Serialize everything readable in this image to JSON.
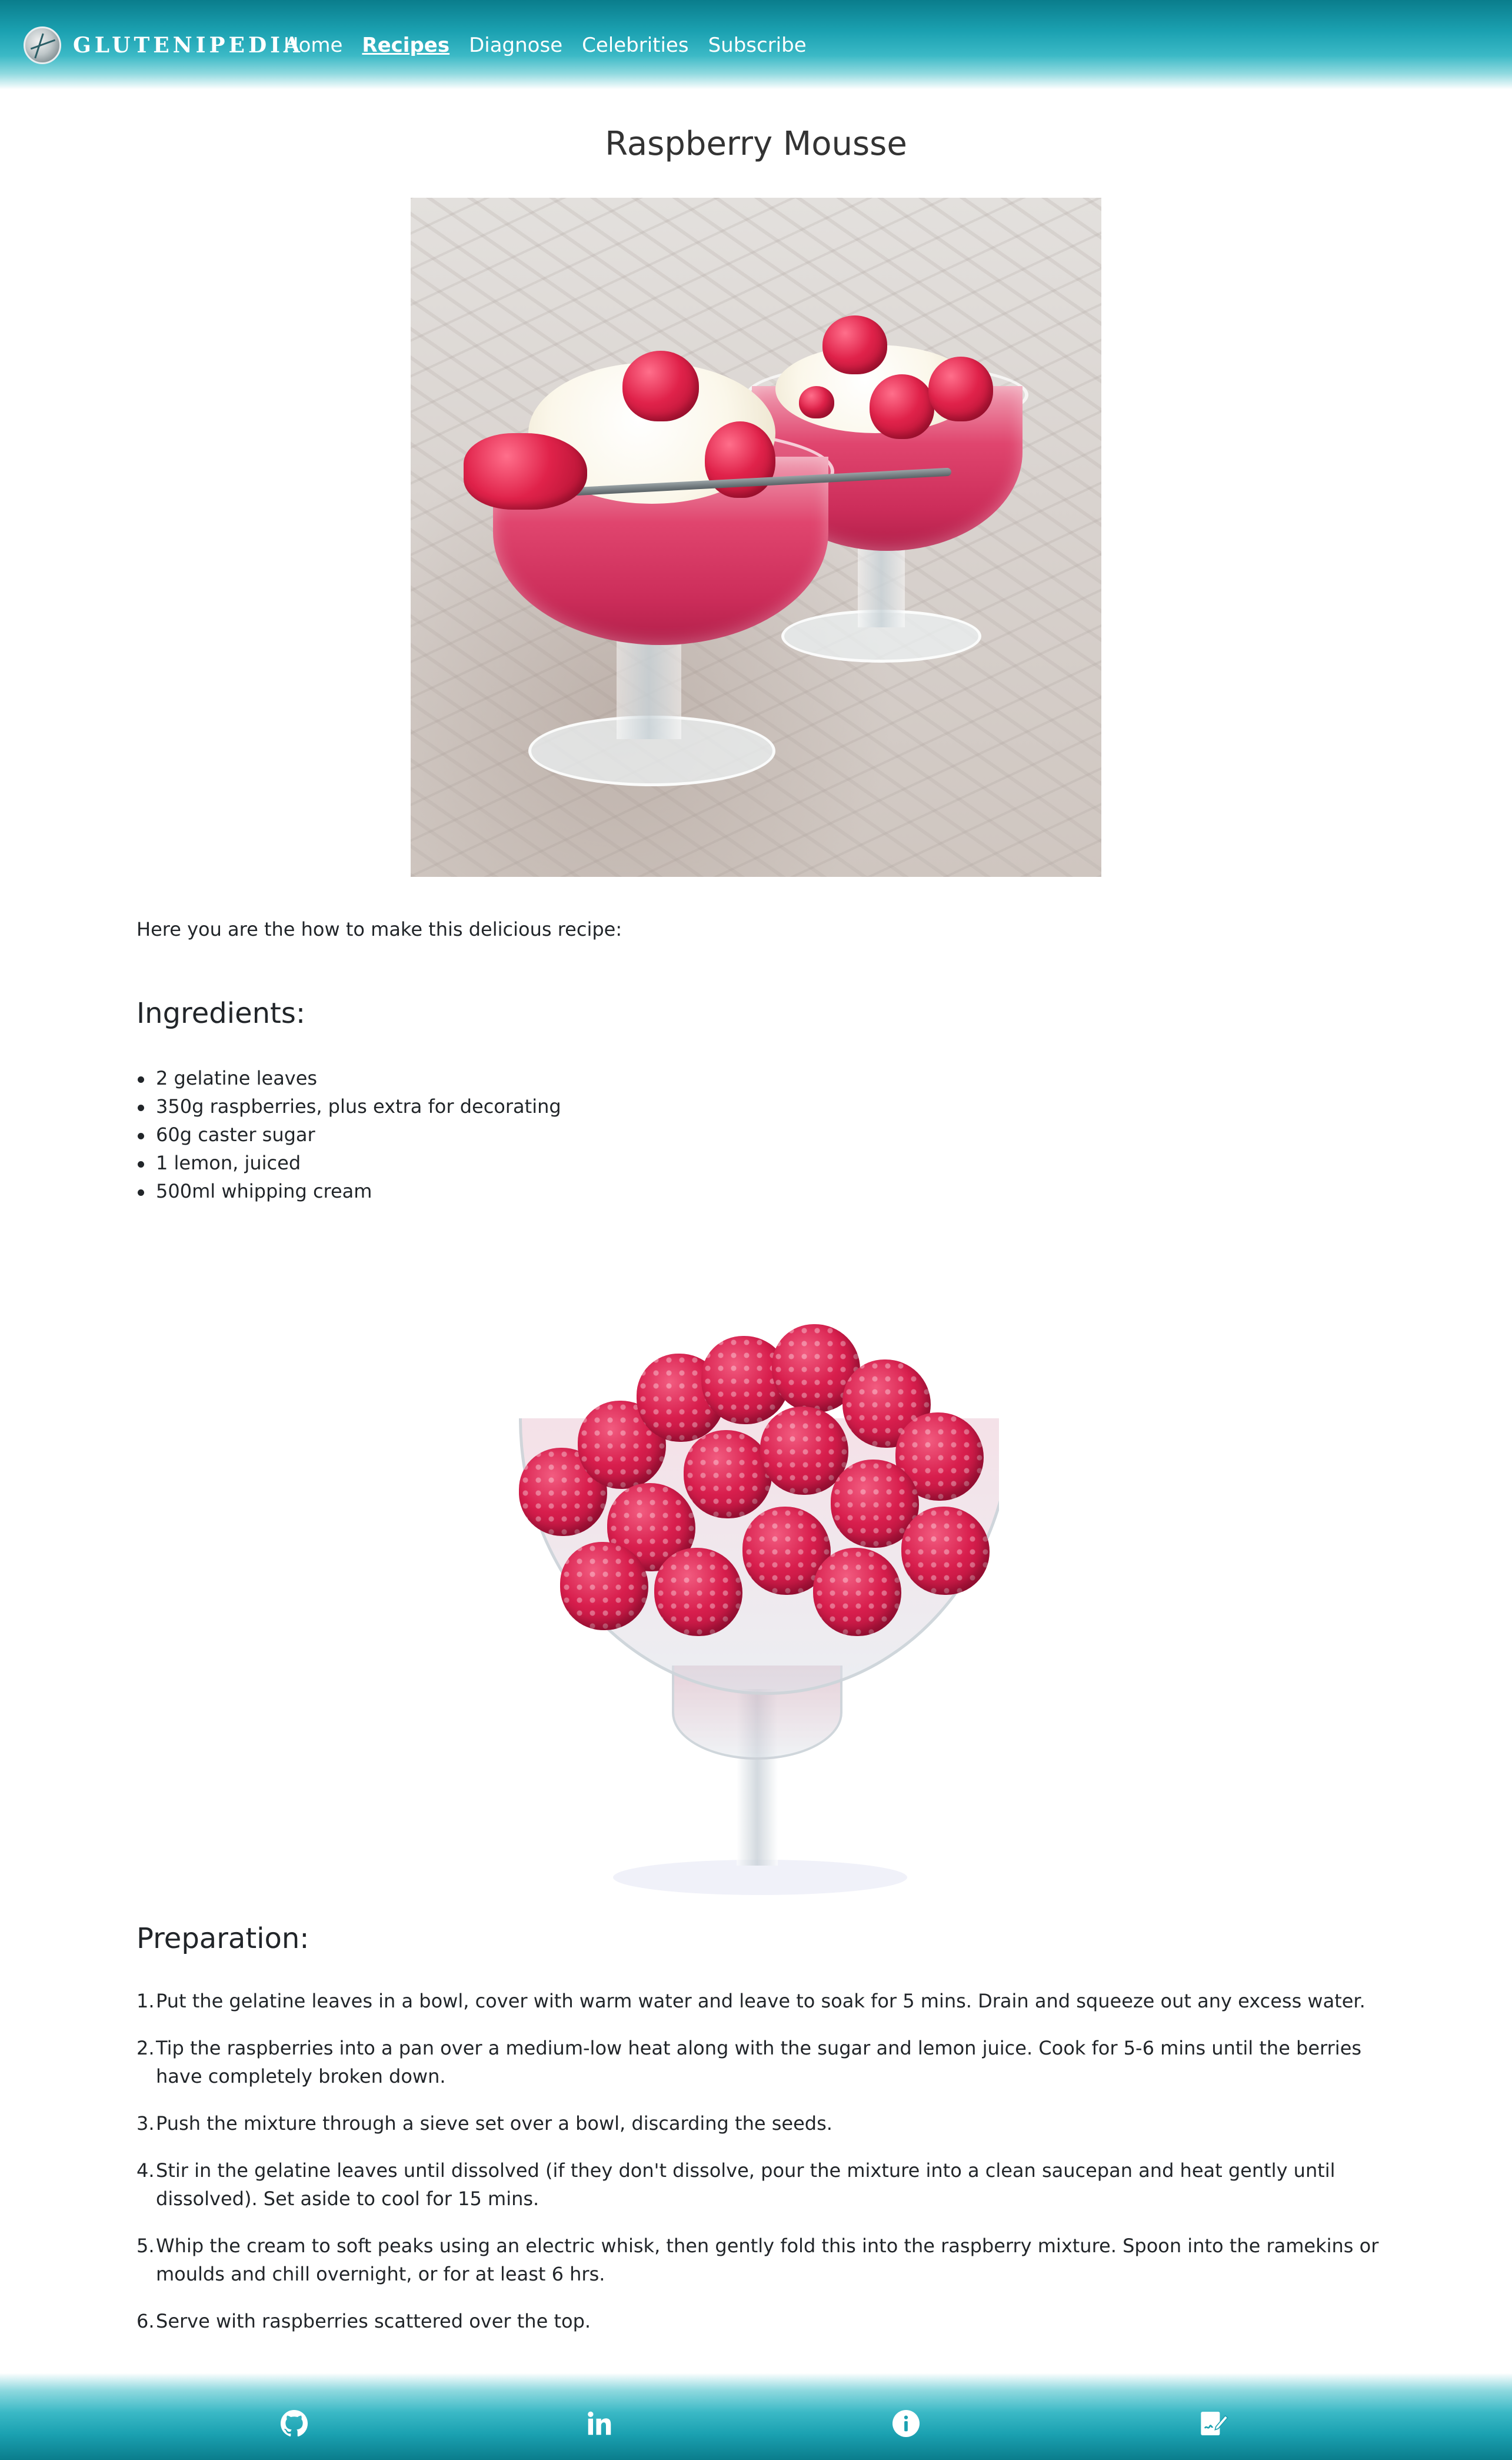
{
  "brand": {
    "name": "GluteniPedia"
  },
  "nav": {
    "items": [
      {
        "label": "Home"
      },
      {
        "label": "Recipes"
      },
      {
        "label": "Diagnose"
      },
      {
        "label": "Celebrities"
      },
      {
        "label": "Subscribe"
      }
    ],
    "active": "Recipes"
  },
  "recipe": {
    "title": "Raspberry Mousse",
    "intro": "Here you are the how to make this delicious recipe:",
    "ingredients_heading": "Ingredients:",
    "ingredients": [
      "2 gelatine leaves",
      "350g raspberries, plus extra for decorating",
      "60g caster sugar",
      "1 lemon, juiced",
      "500ml whipping cream"
    ],
    "preparation_heading": "Preparation:",
    "steps": [
      {
        "num": "1.",
        "text": "Put the gelatine leaves in a bowl, cover with warm water and leave to soak for 5 mins. Drain and squeeze out any excess water."
      },
      {
        "num": "2.",
        "text": "Tip the raspberries into a pan over a medium-low heat along with the sugar and lemon juice. Cook for 5-6 mins until the berries have completely broken down."
      },
      {
        "num": "3.",
        "text": "Push the mixture through a sieve set over a bowl, discarding the seeds."
      },
      {
        "num": "4.",
        "text": "Stir in the gelatine leaves until dissolved (if they don't dissolve, pour the mixture into a clean saucepan and heat gently until dissolved). Set aside to cool for 15 mins."
      },
      {
        "num": "5.",
        "text": "Whip the cream to soft peaks using an electric whisk, then gently fold this into the raspberry mixture. Spoon into the ramekins or moulds and chill overnight, or for at least 6 hrs."
      },
      {
        "num": "6.",
        "text": "Serve with raspberries scattered over the top."
      }
    ]
  },
  "footer": {
    "icons": [
      "github-icon",
      "linkedin-icon",
      "info-icon",
      "signature-icon"
    ]
  },
  "colors": {
    "header_dark": "#0a7d8c",
    "header_mid": "#3bb9c6",
    "text": "#212529",
    "title": "#333333"
  }
}
